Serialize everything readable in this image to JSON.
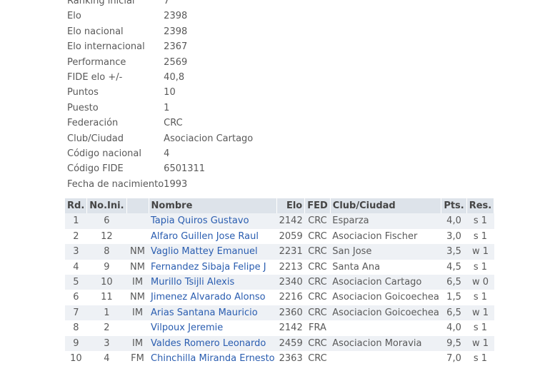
{
  "player_info": [
    {
      "label": "Ranking inicial",
      "value": "7"
    },
    {
      "label": "Elo",
      "value": "2398"
    },
    {
      "label": "Elo nacional",
      "value": "2398"
    },
    {
      "label": "Elo internacional",
      "value": "2367"
    },
    {
      "label": "Performance",
      "value": "2569"
    },
    {
      "label": "FIDE elo +/-",
      "value": "40,8"
    },
    {
      "label": "Puntos",
      "value": "10"
    },
    {
      "label": "Puesto",
      "value": "1"
    },
    {
      "label": "Federación",
      "value": "CRC"
    },
    {
      "label": "Club/Ciudad",
      "value": "Asociacion Cartago"
    },
    {
      "label": "Código nacional",
      "value": "4"
    },
    {
      "label": "Código FIDE",
      "value": "6501311"
    },
    {
      "label": "Fecha de nacimiento",
      "value": "1993"
    }
  ],
  "games_table": {
    "headers": [
      "Rd.",
      "No.Ini.",
      "",
      "Nombre",
      "Elo",
      "FED",
      "Club/Ciudad",
      "Pts.",
      "Res."
    ],
    "rows": [
      [
        "1",
        "6",
        "",
        "Tapia Quiros Gustavo",
        "2142",
        "CRC",
        "Esparza",
        "4,0",
        "s 1"
      ],
      [
        "2",
        "12",
        "",
        "Alfaro Guillen Jose Raul",
        "2059",
        "CRC",
        "Asociacion Fischer",
        "3,0",
        "s 1"
      ],
      [
        "3",
        "8",
        "NM",
        "Vaglio Mattey Emanuel",
        "2231",
        "CRC",
        "San Jose",
        "3,5",
        "w 1"
      ],
      [
        "4",
        "9",
        "NM",
        "Fernandez Sibaja Felipe J",
        "2213",
        "CRC",
        "Santa Ana",
        "4,5",
        "s 1"
      ],
      [
        "5",
        "10",
        "IM",
        "Murillo Tsijli Alexis",
        "2340",
        "CRC",
        "Asociacion Cartago",
        "6,5",
        "w 0"
      ],
      [
        "6",
        "11",
        "NM",
        "Jimenez Alvarado Alonso",
        "2216",
        "CRC",
        "Asociacion Goicoechea",
        "1,5",
        "s 1"
      ],
      [
        "7",
        "1",
        "IM",
        "Arias Santana Mauricio",
        "2360",
        "CRC",
        "Asociacion Goicoechea",
        "6,5",
        "w 1"
      ],
      [
        "8",
        "2",
        "",
        "Vilpoux Jeremie",
        "2142",
        "FRA",
        "",
        "4,0",
        "s 1"
      ],
      [
        "9",
        "3",
        "IM",
        "Valdes Romero Leonardo",
        "2459",
        "CRC",
        "Asociacion Moravia",
        "9,5",
        "w 1"
      ],
      [
        "10",
        "4",
        "FM",
        "Chinchilla Miranda Ernesto",
        "2363",
        "CRC",
        "",
        "7,0",
        "s 1"
      ]
    ]
  }
}
